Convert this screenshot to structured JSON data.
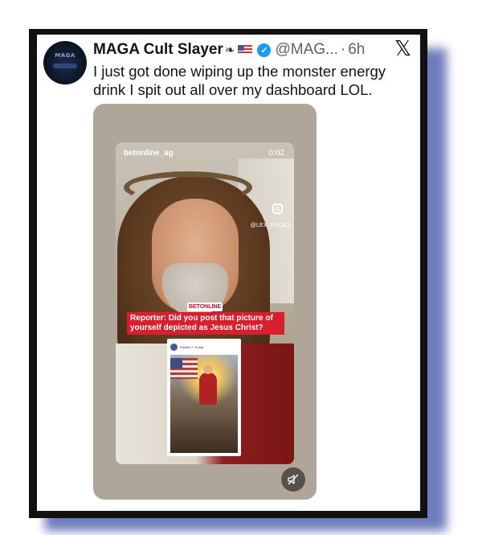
{
  "tweet": {
    "author_name": "MAGA Cult Slayer",
    "handle": "@MAG...",
    "separator": "·",
    "time_ago": "6h",
    "text": "I just got done wiping up the monster energy drink I spit out all over my dashboard LOL.",
    "avatar_text": "MAGA"
  },
  "video": {
    "username": "betonline_ag",
    "duration": "0:02",
    "watermark": "@LEX_FROES",
    "brand_logo": "BETONLINE",
    "caption": "Reporter: Did you post that picture of yourself depicted as Jesus Christ?",
    "inset_author": "Donald J. Trump"
  },
  "icons": {
    "verified": "verified-badge-icon",
    "platform": "x-logo-icon",
    "instagram": "instagram-icon",
    "mute": "speaker-muted-icon"
  },
  "colors": {
    "frame": "#111111",
    "shadow": "#5566b0",
    "verified": "#1d9bf0",
    "caption_bg": "#d91f2e"
  }
}
